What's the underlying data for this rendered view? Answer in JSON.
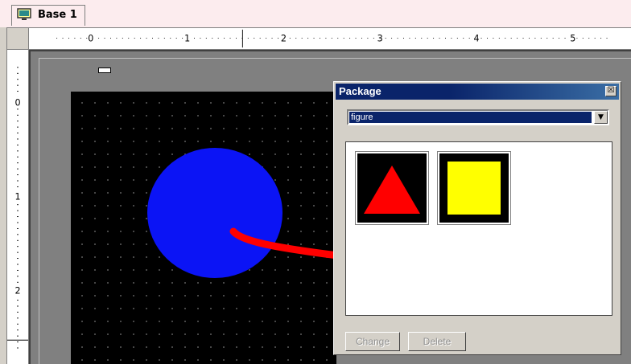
{
  "tab": {
    "label": "Base 1",
    "icon": "screen-icon"
  },
  "rulers": {
    "horizontal_ticks": [
      "0",
      "1",
      "2",
      "3",
      "4",
      "5"
    ],
    "vertical_ticks": [
      "0",
      "1",
      "2"
    ]
  },
  "package_dialog": {
    "title": "Package",
    "close_glyph": "☒",
    "category": {
      "selected": "figure"
    },
    "items": [
      {
        "name": "red-triangle",
        "shape": "triangle",
        "color": "#ff0000"
      },
      {
        "name": "yellow-square",
        "shape": "square",
        "color": "#ffff00"
      }
    ],
    "buttons": {
      "change": "Change",
      "delete": "Delete"
    }
  },
  "canvas": {
    "circle_color": "#0b14f5",
    "arrow_color": "#ff0000"
  }
}
